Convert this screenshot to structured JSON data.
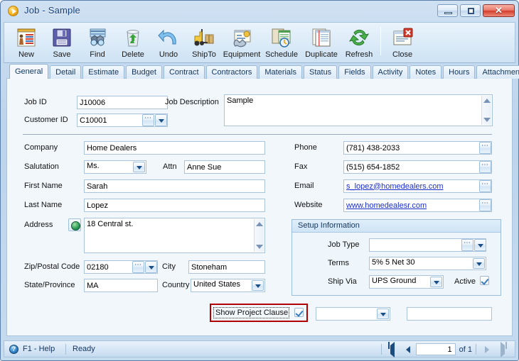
{
  "window": {
    "title": "Job - Sample",
    "title_icon": "play-circle-icon",
    "buttons": {
      "minimize": "minimize-icon",
      "maximize": "maximize-icon",
      "close": "✕"
    }
  },
  "toolbar": {
    "items": [
      {
        "label": "New",
        "icon": "new-document-icon"
      },
      {
        "label": "Save",
        "icon": "floppy-disk-icon"
      },
      {
        "label": "Find",
        "icon": "binoculars-icon"
      },
      {
        "label": "Delete",
        "icon": "recycle-bin-icon"
      },
      {
        "label": "Undo",
        "icon": "undo-arrow-icon"
      },
      {
        "label": "ShipTo",
        "icon": "forklift-icon"
      },
      {
        "label": "Equipment",
        "icon": "wrench-icon"
      },
      {
        "label": "Schedule",
        "icon": "calendar-clock-icon"
      },
      {
        "label": "Duplicate",
        "icon": "copy-pages-icon"
      },
      {
        "label": "Refresh",
        "icon": "refresh-arrows-icon"
      }
    ],
    "close": {
      "label": "Close",
      "icon": "close-window-icon"
    }
  },
  "tabs": [
    {
      "label": "General",
      "active": true
    },
    {
      "label": "Detail",
      "active": false
    },
    {
      "label": "Estimate",
      "active": false
    },
    {
      "label": "Budget",
      "active": false
    },
    {
      "label": "Contract",
      "active": false
    },
    {
      "label": "Contractors",
      "active": false
    },
    {
      "label": "Materials",
      "active": false
    },
    {
      "label": "Status",
      "active": false
    },
    {
      "label": "Fields",
      "active": false
    },
    {
      "label": "Activity",
      "active": false
    },
    {
      "label": "Notes",
      "active": false
    },
    {
      "label": "Hours",
      "active": false
    },
    {
      "label": "Attachment",
      "active": false
    }
  ],
  "form": {
    "job_id": {
      "label": "Job ID",
      "value": "J10006"
    },
    "customer_id": {
      "label": "Customer ID",
      "value": "C10001"
    },
    "job_description": {
      "label": "Job Description",
      "value": "Sample"
    },
    "company": {
      "label": "Company",
      "value": "Home Dealers"
    },
    "salutation": {
      "label": "Salutation",
      "value": "Ms."
    },
    "attn": {
      "label": "Attn",
      "value": "Anne Sue"
    },
    "first_name": {
      "label": "First Name",
      "value": "Sarah"
    },
    "last_name": {
      "label": "Last Name",
      "value": "Lopez"
    },
    "address": {
      "label": "Address",
      "value": "18 Central st."
    },
    "zip": {
      "label": "Zip/Postal Code",
      "value": "02180"
    },
    "city": {
      "label": "City",
      "value": "Stoneham"
    },
    "state": {
      "label": "State/Province",
      "value": "MA"
    },
    "country": {
      "label": "Country",
      "value": "United States"
    },
    "phone": {
      "label": "Phone",
      "value": "(781) 438-2033"
    },
    "fax": {
      "label": "Fax",
      "value": "(515) 654-1852"
    },
    "email": {
      "label": "Email",
      "value": "s_lopez@homedealers.com"
    },
    "website": {
      "label": "Website",
      "value": "www.homedealesr.com"
    }
  },
  "setup": {
    "caption": "Setup Information",
    "job_type": {
      "label": "Job Type",
      "value": ""
    },
    "terms": {
      "label": "Terms",
      "value": "5% 5 Net 30"
    },
    "ship_via": {
      "label": "Ship Via",
      "value": "UPS Ground"
    },
    "active": {
      "label": "Active",
      "checked": true
    }
  },
  "project_clause": {
    "label": "Show Project Clause",
    "checked": true,
    "dropdown_value": "",
    "text_value": "",
    "highlight_color": "#b00000"
  },
  "statusbar": {
    "help": "F1 - Help",
    "help_icon": "?",
    "ready": "Ready",
    "nav": {
      "first": "first-page-icon",
      "prev": "previous-page-icon",
      "next": "next-page-icon",
      "last": "last-page-icon",
      "page": "1",
      "of": "of 1"
    }
  }
}
